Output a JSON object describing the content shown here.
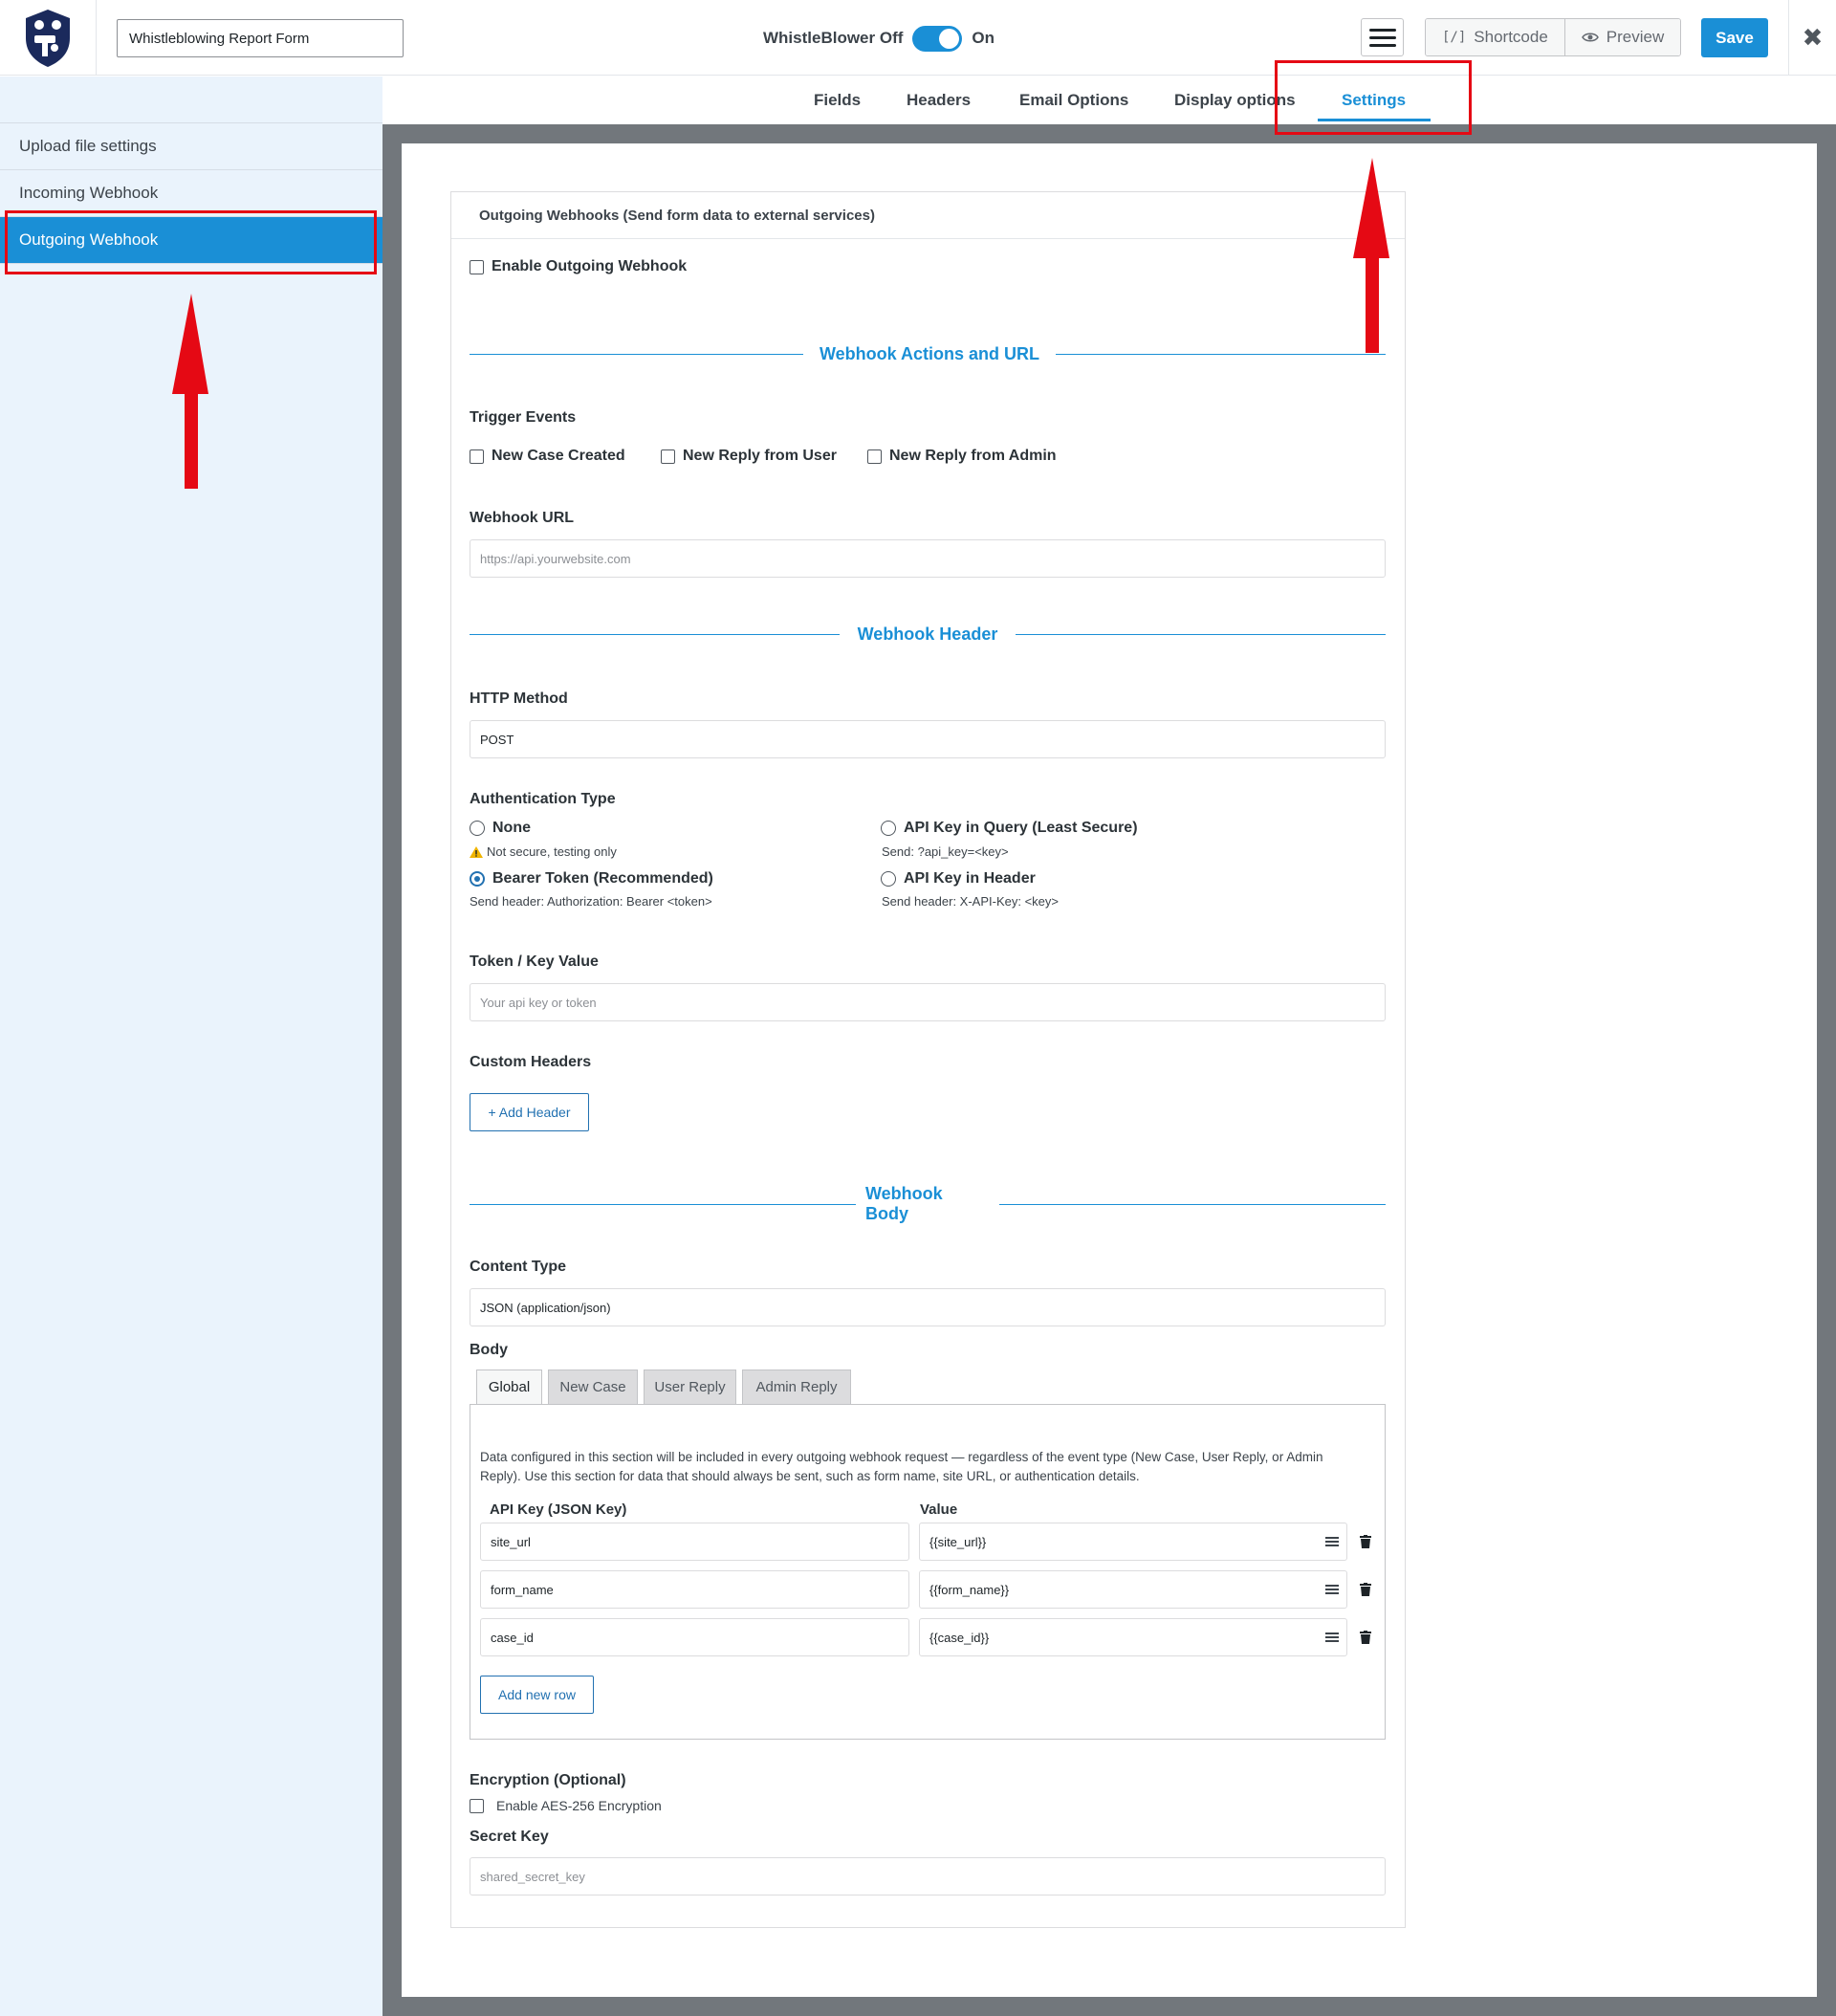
{
  "topbar": {
    "form_title": "Whistleblowing Report Form",
    "toggle_off_label": "WhistleBlower Off",
    "toggle_on_label": "On",
    "shortcode_label": "Shortcode",
    "shortcode_icon": "[/]",
    "preview_label": "Preview",
    "save_label": "Save",
    "close_icon": "✖"
  },
  "sidebar": {
    "items": [
      {
        "label": "Upload file settings"
      },
      {
        "label": "Incoming Webhook"
      },
      {
        "label": "Outgoing Webhook"
      }
    ],
    "active_index": 2
  },
  "tabs": [
    {
      "label": "Fields"
    },
    {
      "label": "Headers"
    },
    {
      "label": "Email Options"
    },
    {
      "label": "Display options"
    },
    {
      "label": "Settings"
    }
  ],
  "card": {
    "title": "Outgoing Webhooks (Send form data to external services)",
    "enable_label": "Enable Outgoing Webhook",
    "section_actions": "Webhook Actions and URL",
    "trigger_label": "Trigger Events",
    "triggers": [
      "New Case Created",
      "New Reply from User",
      "New Reply from Admin"
    ],
    "url_label": "Webhook URL",
    "url_placeholder": "https://api.yourwebsite.com",
    "section_header": "Webhook Header",
    "method_label": "HTTP Method",
    "method_value": "POST",
    "auth_label": "Authentication Type",
    "auth_none": "None",
    "auth_none_note": "Not secure, testing only",
    "auth_query": "API Key in Query (Least Secure)",
    "auth_query_note": "Send: ?api_key=<key>",
    "auth_bearer": "Bearer Token (Recommended)",
    "auth_bearer_note": "Send header: Authorization: Bearer <token>",
    "auth_header": "API Key in Header",
    "auth_header_note": "Send header: X-API-Key: <key>",
    "token_label": "Token / Key Value",
    "token_placeholder": "Your api key or token",
    "custom_headers_label": "Custom Headers",
    "add_header_label": "+ Add Header",
    "section_body": "Webhook Body",
    "content_type_label": "Content Type",
    "content_type_value": "JSON (application/json)",
    "body_label": "Body",
    "body_tabs": [
      "Global",
      "New Case",
      "User Reply",
      "Admin Reply"
    ],
    "body_description": "Data configured in this section will be included in every outgoing webhook request — regardless of the event type (New Case, User Reply, or Admin Reply). Use this section for data that should always be sent, such as form name, site URL, or authentication details.",
    "kv_key_header": "API Key (JSON Key)",
    "kv_value_header": "Value",
    "kv_rows": [
      {
        "key": "site_url",
        "value": "{{site_url}}"
      },
      {
        "key": "form_name",
        "value": "{{form_name}}"
      },
      {
        "key": "case_id",
        "value": "{{case_id}}"
      }
    ],
    "add_row_label": "Add new row",
    "encryption_label": "Encryption (Optional)",
    "encryption_checkbox": "Enable AES-256 Encryption",
    "secret_label": "Secret Key",
    "secret_placeholder": "shared_secret_key"
  },
  "colors": {
    "accent": "#1a8fd6",
    "sidebar_bg": "#eaf3fc",
    "annotation": "#e50914"
  }
}
